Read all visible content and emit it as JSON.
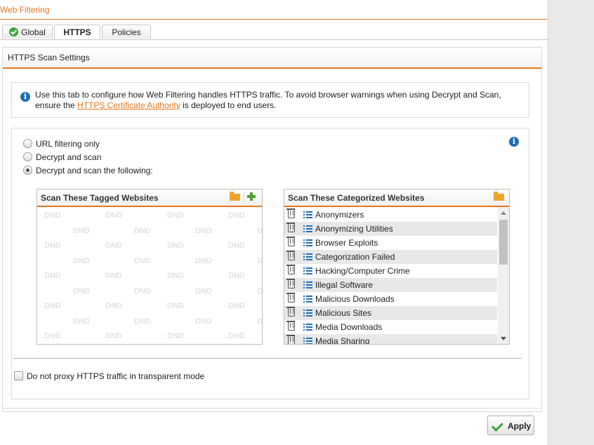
{
  "page": {
    "title": "Web Filtering"
  },
  "tabs": [
    {
      "label": "Global",
      "icon": "check-circle-icon",
      "active": false
    },
    {
      "label": "HTTPS",
      "active": true
    },
    {
      "label": "Policies",
      "active": false
    }
  ],
  "panel": {
    "title": "HTTPS Scan Settings"
  },
  "info": {
    "text_before": "Use this tab to configure how Web Filtering handles HTTPS traffic. To avoid browser warnings when using Decrypt and Scan, ensure the ",
    "link_text": "HTTPS Certificate Authority",
    "text_after": " is deployed to end users."
  },
  "options": [
    {
      "label": "URL filtering only",
      "checked": false
    },
    {
      "label": "Decrypt and scan",
      "checked": false
    },
    {
      "label": "Decrypt and scan the following:",
      "checked": true
    }
  ],
  "tagged_list": {
    "title": "Scan These Tagged Websites",
    "placeholder": "DND"
  },
  "categorized_list": {
    "title": "Scan These Categorized Websites",
    "items": [
      "Anonymizers",
      "Anonymizing Utilities",
      "Browser Exploits",
      "Categorization Failed",
      "Hacking/Computer Crime",
      "Illegal Software",
      "Malicious Downloads",
      "Malicious Sites",
      "Media Downloads",
      "Media Sharing"
    ]
  },
  "transparent_option": {
    "label": "Do not proxy HTTPS traffic in transparent mode",
    "checked": false
  },
  "footer": {
    "apply_label": "Apply"
  },
  "colors": {
    "accent": "#e8761c",
    "info_blue": "#1d6fb8",
    "success_green": "#3aa63a"
  }
}
